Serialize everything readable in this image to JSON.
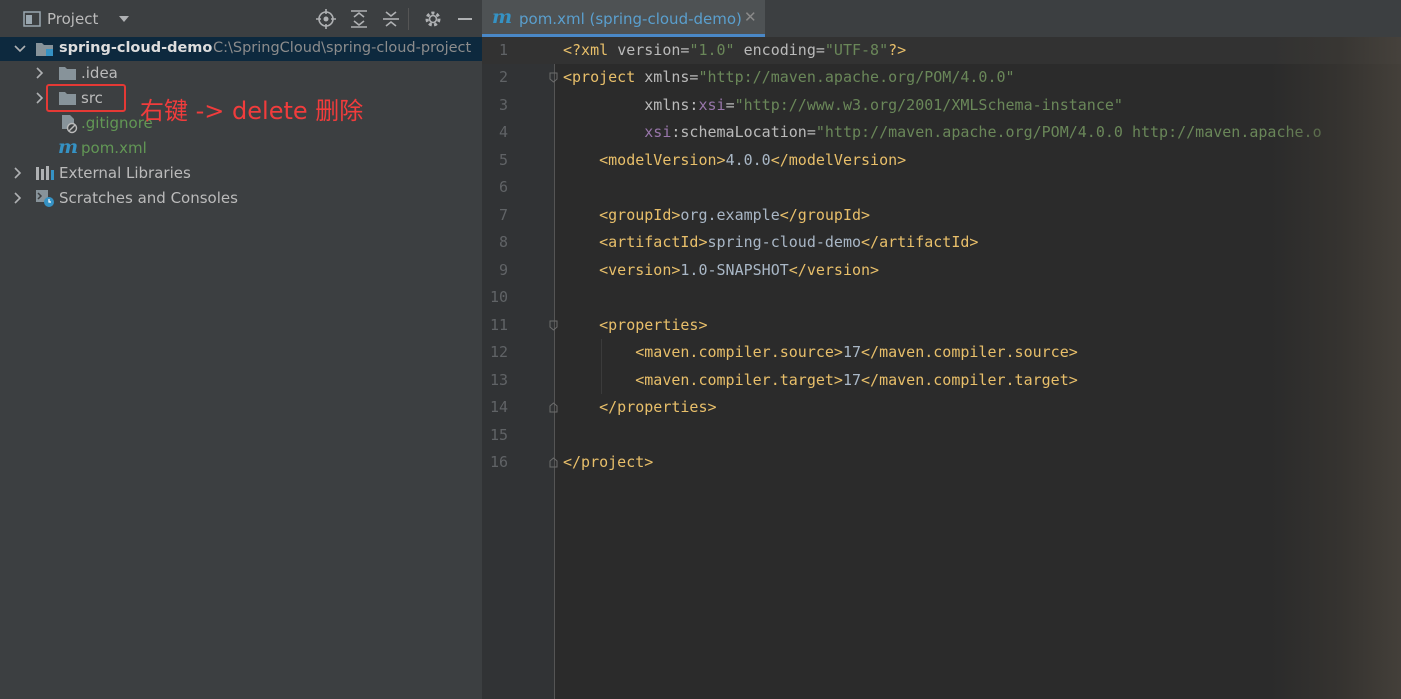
{
  "project_panel": {
    "title": "Project",
    "tree": [
      {
        "label": "spring-cloud-demo",
        "path": "C:\\SpringCloud\\spring-cloud-project"
      },
      {
        "label": ".idea"
      },
      {
        "label": "src"
      },
      {
        "label": ".gitignore"
      },
      {
        "label": "pom.xml"
      },
      {
        "label": "External Libraries"
      },
      {
        "label": "Scratches and Consoles"
      }
    ]
  },
  "annotation": "右键 -> delete 删除",
  "editor": {
    "tab": {
      "icon": "m",
      "label": "pom.xml (spring-cloud-demo)",
      "close": "✕"
    },
    "line_numbers": [
      "1",
      "2",
      "3",
      "4",
      "5",
      "6",
      "7",
      "8",
      "9",
      "10",
      "11",
      "12",
      "13",
      "14",
      "15",
      "16"
    ],
    "lines": [
      "<?xml version=\"1.0\" encoding=\"UTF-8\"?>",
      "<project xmlns=\"http://maven.apache.org/POM/4.0.0\"",
      "         xmlns:xsi=\"http://www.w3.org/2001/XMLSchema-instance\"",
      "         xsi:schemaLocation=\"http://maven.apache.org/POM/4.0.0 http://maven.apache.o",
      "    <modelVersion>4.0.0</modelVersion>",
      "",
      "    <groupId>org.example</groupId>",
      "    <artifactId>spring-cloud-demo</artifactId>",
      "    <version>1.0-SNAPSHOT</version>",
      "",
      "    <properties>",
      "        <maven.compiler.source>17</maven.compiler.source>",
      "        <maven.compiler.target>17</maven.compiler.target>",
      "    </properties>",
      "",
      "</project>"
    ]
  },
  "colors": {
    "tag": "#e8bf6a",
    "attr_value": "#6a8759",
    "namespace": "#9876aa",
    "text": "#a9b7c6",
    "git_ignored": "#629755",
    "annotation_red": "#e53935",
    "selection": "#0d293e"
  },
  "icons": [
    "project-panel-icon",
    "dropdown-icon",
    "locate-icon",
    "expand-all-icon",
    "collapse-all-icon",
    "gear-icon",
    "minimize-icon",
    "module-folder-icon",
    "folder-icon",
    "gitignore-file-icon",
    "maven-file-icon",
    "library-icon",
    "scratches-icon",
    "chevron-right-icon",
    "chevron-down-icon",
    "fold-marker-icon"
  ]
}
